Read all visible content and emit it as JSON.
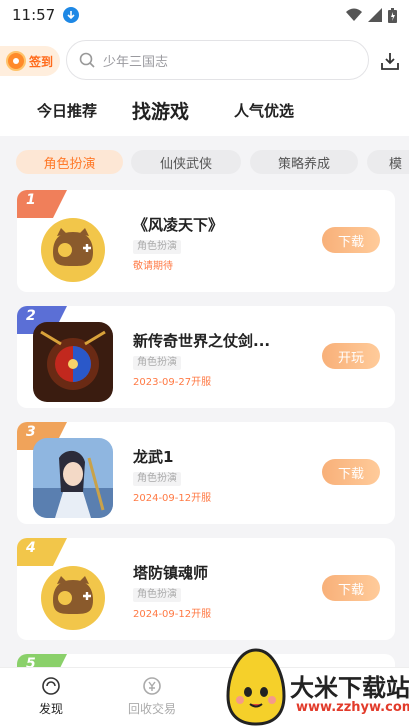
{
  "status": {
    "time": "11:57"
  },
  "topbar": {
    "signin_label": "签到",
    "search_placeholder": "少年三国志"
  },
  "tabs": [
    {
      "label": "今日推荐"
    },
    {
      "label": "找游戏"
    },
    {
      "label": "人气优选"
    }
  ],
  "categories": [
    {
      "label": "角色扮演"
    },
    {
      "label": "仙侠武侠"
    },
    {
      "label": "策略养成"
    },
    {
      "label": "模"
    }
  ],
  "games": [
    {
      "rank": "1",
      "name": "《风凌天下》",
      "tag": "角色扮演",
      "date": "敬请期待",
      "button": "下载",
      "rank_color": "#f07f5a",
      "icon": "mascot-icon"
    },
    {
      "rank": "2",
      "name": "新传奇世界之仗剑...",
      "tag": "角色扮演",
      "date": "2023-09-27开服",
      "button": "开玩",
      "rank_color": "#5b6fd6",
      "icon": "game-art-icon"
    },
    {
      "rank": "3",
      "name": "龙武1",
      "tag": "角色扮演",
      "date": "2024-09-12开服",
      "button": "下载",
      "rank_color": "#f0a35a",
      "icon": "game-art-icon"
    },
    {
      "rank": "4",
      "name": "塔防镇魂师",
      "tag": "角色扮演",
      "date": "2024-09-12开服",
      "button": "下载",
      "rank_color": "#f2c64a",
      "icon": "mascot-icon"
    },
    {
      "rank": "5",
      "rank_color": "#8ad06a"
    }
  ],
  "bottom_nav": [
    {
      "label": "发现"
    },
    {
      "label": "回收交易"
    }
  ],
  "watermark": {
    "title": "大米下载站",
    "url": "www.zzhyw.com"
  },
  "colors": {
    "accent": "#ff7a2a",
    "button_gradient": "#f8b079"
  }
}
